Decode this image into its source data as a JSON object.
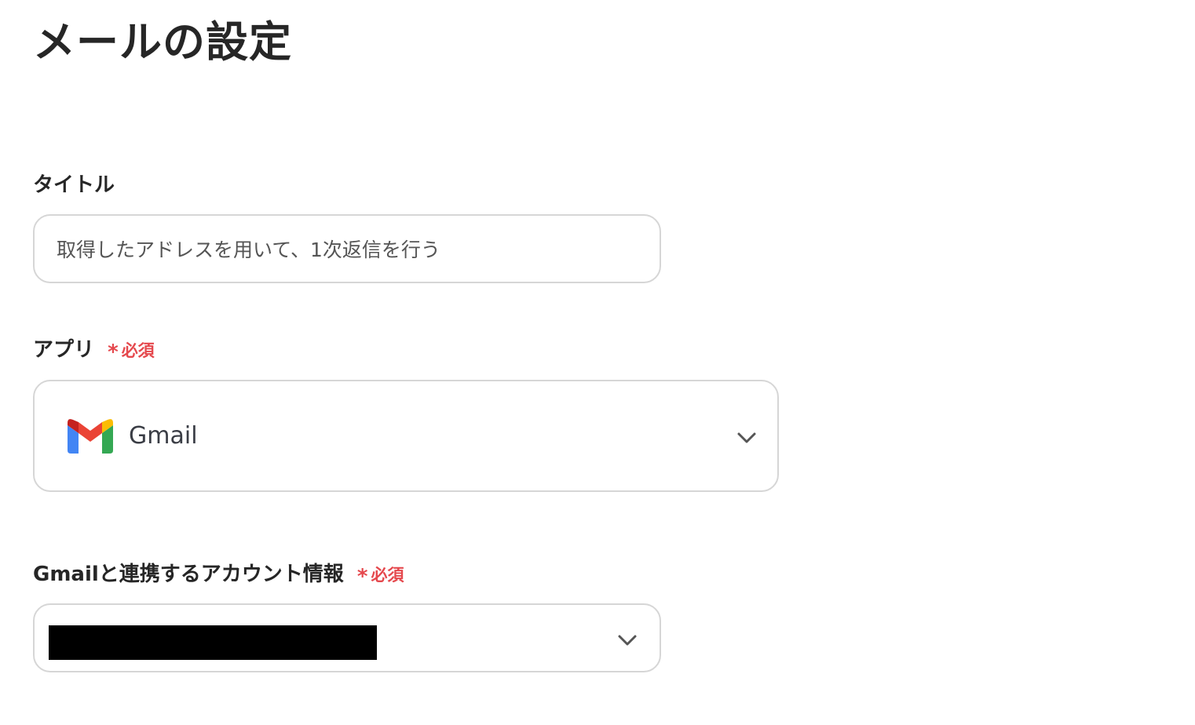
{
  "page": {
    "title": "メールの設定"
  },
  "title_field": {
    "label": "タイトル",
    "value": "取得したアドレスを用いて、1次返信を行う"
  },
  "app_field": {
    "label": "アプリ",
    "required_star": "*",
    "required_text": "必須",
    "selected_app": "Gmail",
    "app_icon": "gmail-logo-icon"
  },
  "account_field": {
    "label": "Gmailと連携するアカウント情報",
    "required_star": "*",
    "required_text": "必須",
    "selected_value_redacted": true
  },
  "colors": {
    "required": "#e5484d",
    "border": "#d6d6d6",
    "text": "#262626",
    "gmail_red": "#EA4335",
    "gmail_blue": "#4285F4",
    "gmail_green": "#34A853",
    "gmail_yellow": "#FBBC04",
    "gmail_dark_red": "#C5221F"
  }
}
